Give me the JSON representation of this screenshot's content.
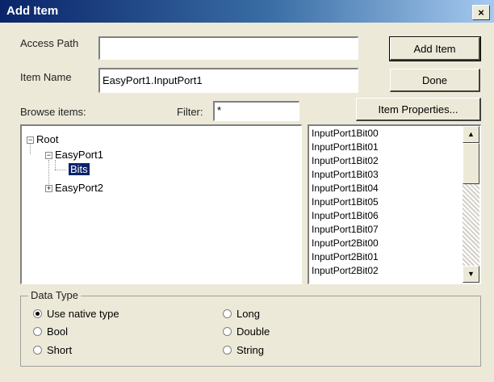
{
  "window": {
    "title": "Add Item",
    "close_label": "×"
  },
  "access_path": {
    "label": "Access Path",
    "value": ""
  },
  "item_name": {
    "label": "Item Name",
    "value": "EasyPort1.InputPort1"
  },
  "buttons": {
    "add_item": "Add Item",
    "done": "Done",
    "item_properties": "Item Properties..."
  },
  "browse": {
    "label": "Browse items:",
    "filter_label": "Filter:",
    "filter_value": "*"
  },
  "tree": {
    "root": "Root",
    "nodes": [
      {
        "label": "EasyPort1",
        "expanded": true
      },
      {
        "label": "Bits",
        "selected": true
      },
      {
        "label": "EasyPort2",
        "expanded": false
      }
    ],
    "expand_glyph": "+",
    "collapse_glyph": "−"
  },
  "items_list": [
    "InputPort1Bit00",
    "InputPort1Bit01",
    "InputPort1Bit02",
    "InputPort1Bit03",
    "InputPort1Bit04",
    "InputPort1Bit05",
    "InputPort1Bit06",
    "InputPort1Bit07",
    "InputPort2Bit00",
    "InputPort2Bit01",
    "InputPort2Bit02"
  ],
  "scroll": {
    "up_glyph": "▲",
    "down_glyph": "▼"
  },
  "data_type": {
    "title": "Data Type",
    "options": [
      {
        "label": "Use native type",
        "checked": true
      },
      {
        "label": "Bool",
        "checked": false
      },
      {
        "label": "Short",
        "checked": false
      },
      {
        "label": "Long",
        "checked": false
      },
      {
        "label": "Double",
        "checked": false
      },
      {
        "label": "String",
        "checked": false
      }
    ]
  }
}
